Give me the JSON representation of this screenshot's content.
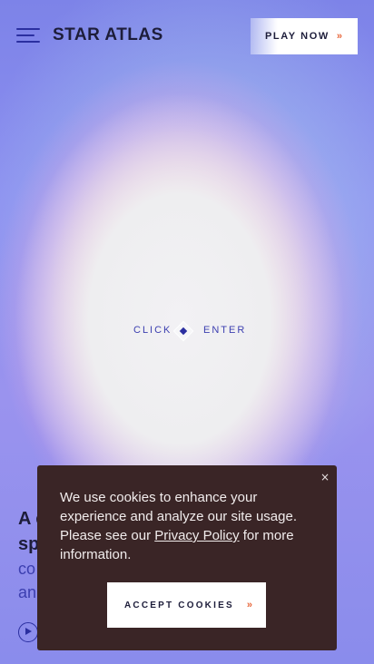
{
  "header": {
    "logo_text": "STAR ATLAS",
    "play_label": "PLAY NOW",
    "play_chevron": "»"
  },
  "center": {
    "click_label": "CLICK",
    "enter_label": "ENTER"
  },
  "hero": {
    "line1": "A c",
    "line2": "sp",
    "line3": "co",
    "line4": "an"
  },
  "cookie_banner": {
    "close_label": "×",
    "message_before": "We use cookies to enhance your experience and analyze our site usage. Please see our ",
    "privacy_link": "Privacy Policy",
    "message_after": " for more information.",
    "accept_label": "ACCEPT COOKIES",
    "accept_chevron": "»"
  },
  "colors": {
    "accent": "#e8663a",
    "primary": "#2b2fa0",
    "banner_bg": "#3a2526"
  }
}
